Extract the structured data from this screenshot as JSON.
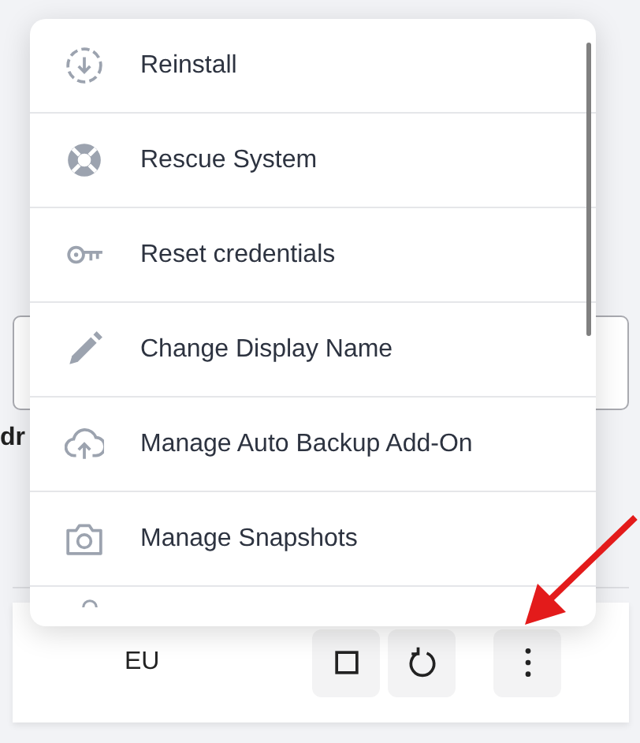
{
  "background": {
    "field_label_fragment": "dr",
    "row": {
      "region": "EU",
      "buttons": [
        {
          "kind": "stop"
        },
        {
          "kind": "restart"
        },
        {
          "kind": "more"
        }
      ]
    }
  },
  "menu": {
    "items": [
      {
        "label": "Reinstall"
      },
      {
        "label": "Rescue System"
      },
      {
        "label": "Reset credentials"
      },
      {
        "label": "Change Display Name"
      },
      {
        "label": "Manage Auto Backup Add-On"
      },
      {
        "label": "Manage Snapshots"
      }
    ]
  },
  "annotation": {
    "kind": "arrow"
  }
}
